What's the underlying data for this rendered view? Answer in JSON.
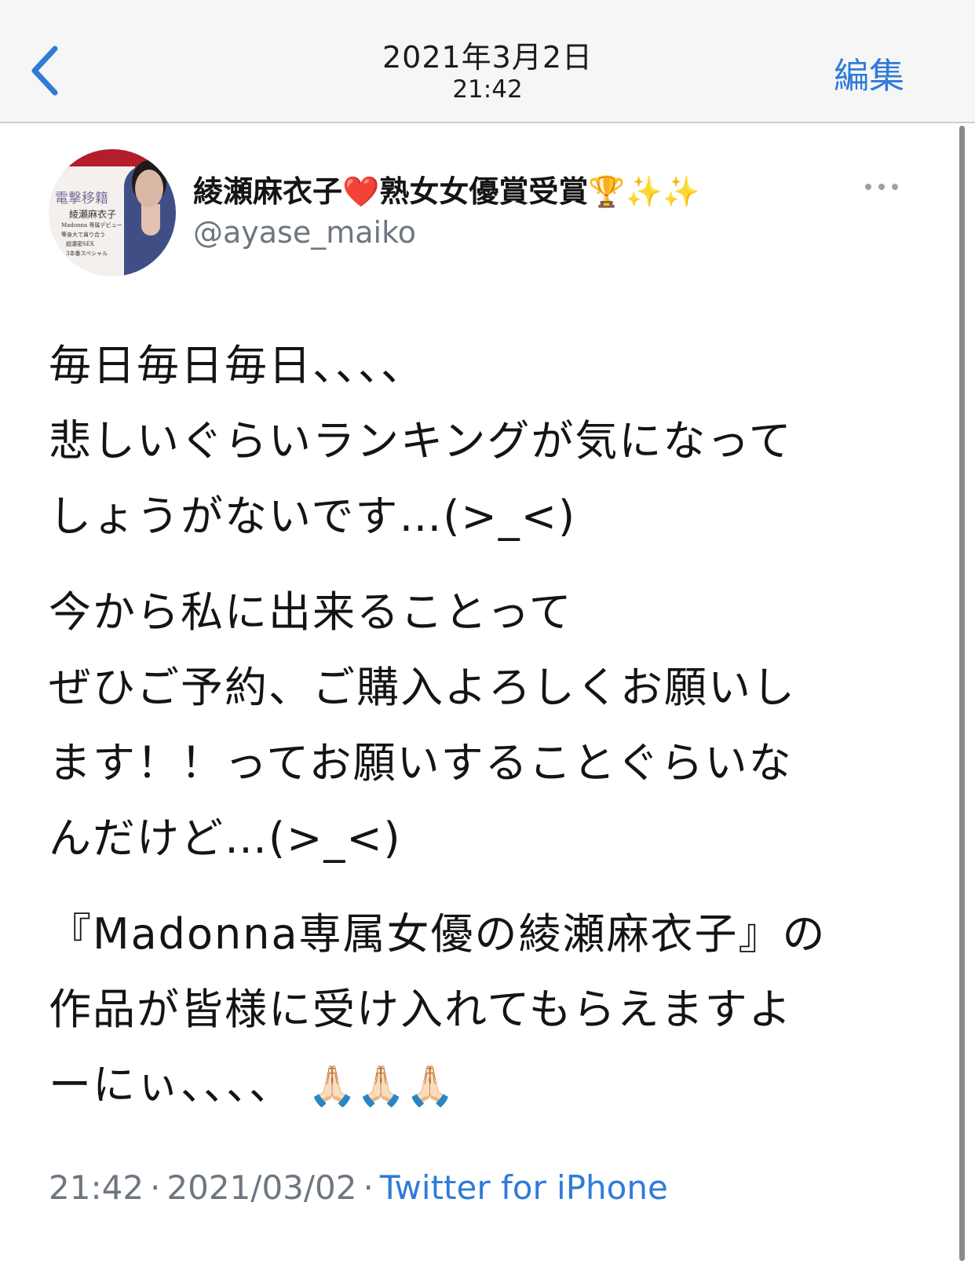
{
  "nav": {
    "date": "2021年3月2日",
    "time": "21:42",
    "edit_label": "編集",
    "back_icon": "chevron-left-icon",
    "accent_color": "#2f7bd8"
  },
  "tweet": {
    "author": {
      "name_text": "綾瀬麻衣子",
      "name_badge": "熟女女優賞受賞",
      "heart_emoji": "❤️",
      "trophy_emoji": "🏆",
      "sparkles_emoji": "✨✨",
      "handle": "@ayase_maiko",
      "avatar_text": {
        "line1": "電撃移籍",
        "line2": "綾瀬麻衣子",
        "line3": "Madonna 専属デビュー",
        "line4": "等身大で貪り合う",
        "line5": "超濃密SEX",
        "line6": "3本番スペシャル"
      }
    },
    "paragraphs": [
      "毎日毎日毎日、、、、\n悲しいぐらいランキングが気になって\nしょうがないです…(>_<)",
      "今から私に出来ることって\nぜひご予約、ご購入よろしくお願いし\nます！！ってお願いすることぐらいな\nんだけど…(>_<)",
      "『Madonna専属女優の綾瀬麻衣子』の\n作品が皆様に受け入れてもらえますよ\nーにぃ、、、、"
    ],
    "pray_emojis": "🙏🏻🙏🏻🙏🏻",
    "meta": {
      "time": "21:42",
      "separator": "·",
      "date": "2021/03/02",
      "client": "Twitter for iPhone"
    }
  }
}
